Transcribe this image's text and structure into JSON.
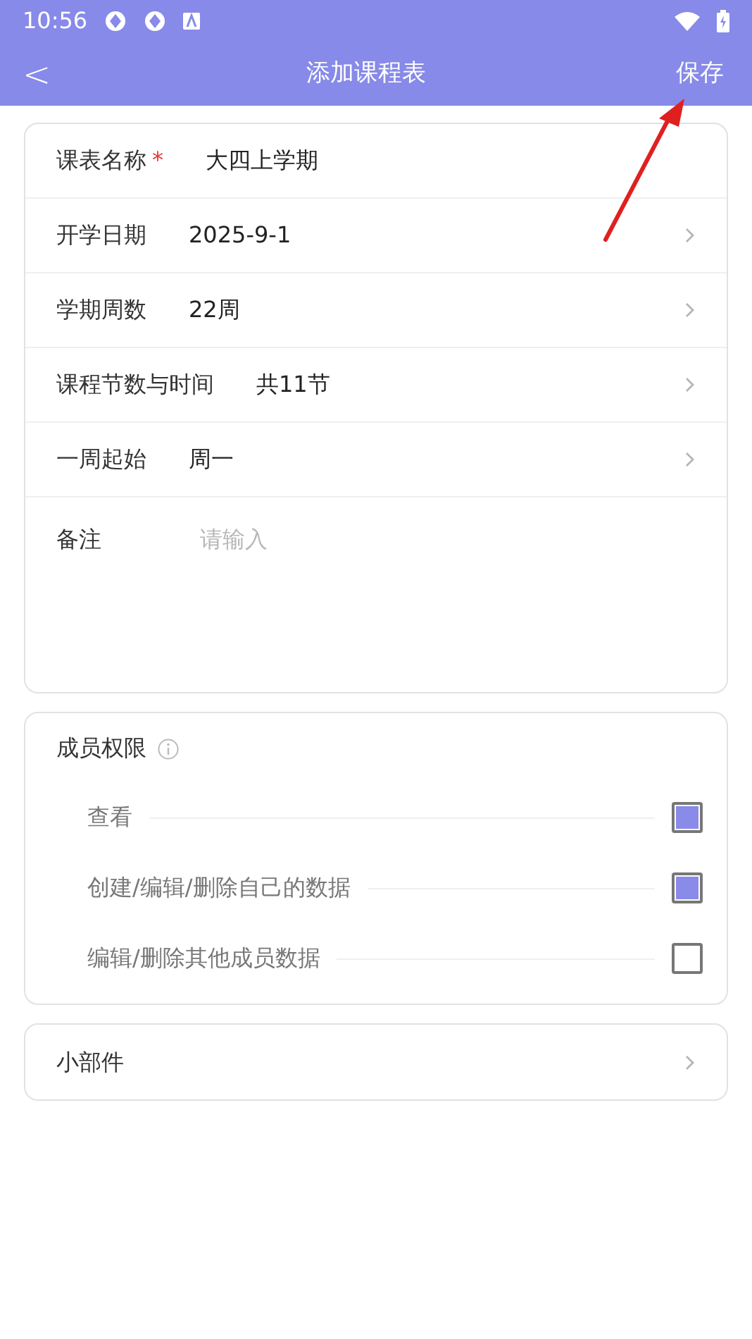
{
  "status_bar": {
    "time": "10:56"
  },
  "header": {
    "back": "<",
    "title": "添加课程表",
    "action": "保存"
  },
  "form": [
    {
      "kind": "text",
      "label": "课表名称",
      "required_mark": "*",
      "value": "大四上学期"
    },
    {
      "kind": "select",
      "label": "开学日期",
      "value": "2025-9-1"
    },
    {
      "kind": "select",
      "label": "学期周数",
      "value": "22周"
    },
    {
      "kind": "select",
      "label": "课程节数与时间",
      "value": "共11节"
    },
    {
      "kind": "select",
      "label": "一周起始",
      "value": "周一"
    },
    {
      "kind": "textarea",
      "label": "备注",
      "placeholder": "请输入"
    }
  ],
  "permissions": {
    "title": "成员权限",
    "items": [
      {
        "label": "查看",
        "checked": true
      },
      {
        "label": "创建/编辑/删除自己的数据",
        "checked": true
      },
      {
        "label": "编辑/删除其他成员数据",
        "checked": false
      }
    ]
  },
  "widget": {
    "label": "小部件"
  }
}
